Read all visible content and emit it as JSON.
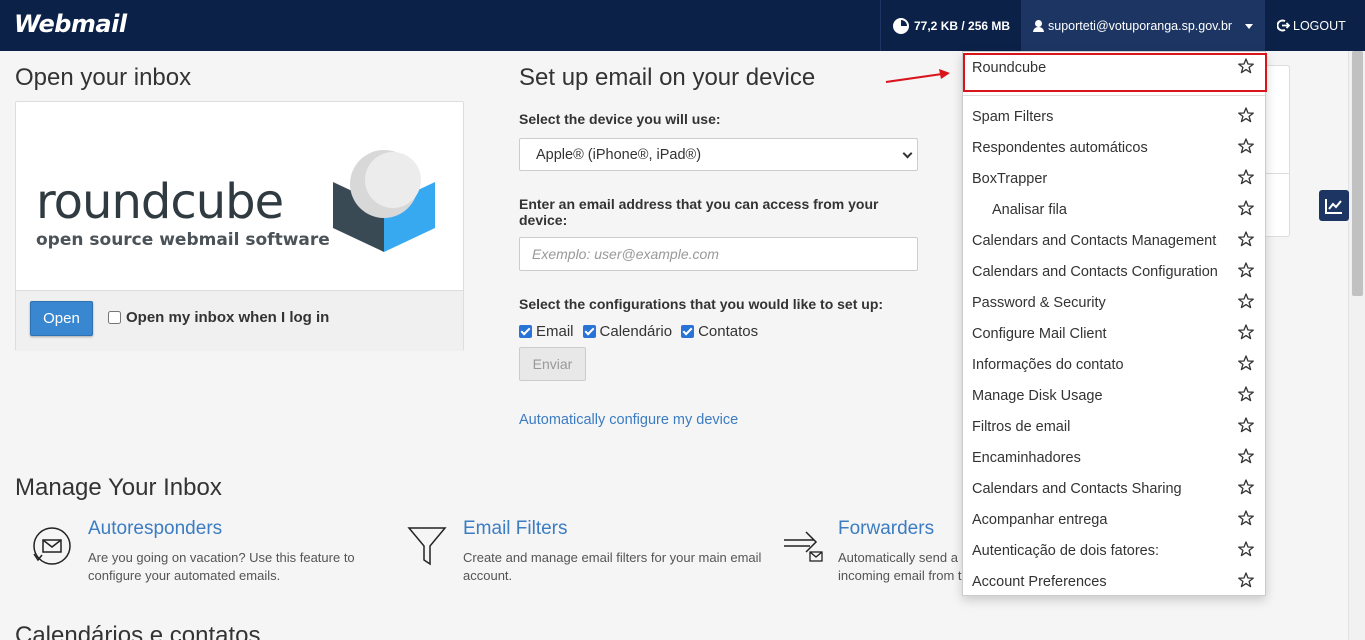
{
  "header": {
    "logo": "Webmail",
    "quota": "77,2 KB / 256 MB",
    "user": "suporteti@votuporanga.sp.gov.br",
    "logout": "LOGOUT"
  },
  "open_inbox": {
    "title": "Open your inbox",
    "client_logo": "roundcube",
    "client_tagline": "open source webmail software",
    "open_button": "Open",
    "open_on_login_label": "Open my inbox when I log in",
    "open_on_login_checked": false
  },
  "setup": {
    "title": "Set up email on your device",
    "device_label": "Select the device you will use:",
    "device_selected": "Apple® (iPhone®, iPad®)",
    "email_label": "Enter an email address that you can access from your device:",
    "email_placeholder": "Exemplo: user@example.com",
    "config_label": "Select the configurations that you would like to set up:",
    "options": [
      {
        "label": "Email",
        "checked": true
      },
      {
        "label": "Calendário",
        "checked": true
      },
      {
        "label": "Contatos",
        "checked": true
      }
    ],
    "submit_button": "Enviar",
    "auto_link": "Automatically configure my device"
  },
  "manage": {
    "title": "Manage Your Inbox",
    "features": [
      {
        "title": "Autoresponders",
        "desc": "Are you going on vacation? Use this feature to configure your automated emails.",
        "icon": "autoresponder-icon"
      },
      {
        "title": "Email Filters",
        "desc": "Create and manage email filters for your main email account.",
        "icon": "filter-icon"
      },
      {
        "title": "Forwarders",
        "desc": "Automatically send a copy of any incoming email from this email",
        "icon": "forwarder-icon"
      }
    ]
  },
  "calendars": {
    "title": "Calendários e contatos"
  },
  "dropdown": {
    "items": [
      {
        "label": "Roundcube",
        "sub": false
      },
      {
        "label": "Spam Filters",
        "sub": false
      },
      {
        "label": "Respondentes automáticos",
        "sub": false
      },
      {
        "label": "BoxTrapper",
        "sub": false
      },
      {
        "label": "Analisar fila",
        "sub": true
      },
      {
        "label": "Calendars and Contacts Management",
        "sub": false
      },
      {
        "label": "Calendars and Contacts Configuration",
        "sub": false
      },
      {
        "label": "Password & Security",
        "sub": false
      },
      {
        "label": "Configure Mail Client",
        "sub": false
      },
      {
        "label": "Informações do contato",
        "sub": false
      },
      {
        "label": "Manage Disk Usage",
        "sub": false
      },
      {
        "label": "Filtros de email",
        "sub": false
      },
      {
        "label": "Encaminhadores",
        "sub": false
      },
      {
        "label": "Calendars and Contacts Sharing",
        "sub": false
      },
      {
        "label": "Acompanhar entrega",
        "sub": false
      },
      {
        "label": "Autenticação de dois fatores:",
        "sub": false
      },
      {
        "label": "Account Preferences",
        "sub": false
      }
    ]
  },
  "colors": {
    "header_bg": "#0b2148",
    "accent_blue": "#3a87d1",
    "link_blue": "#3b7cc2",
    "highlight_red": "#d9141b"
  }
}
